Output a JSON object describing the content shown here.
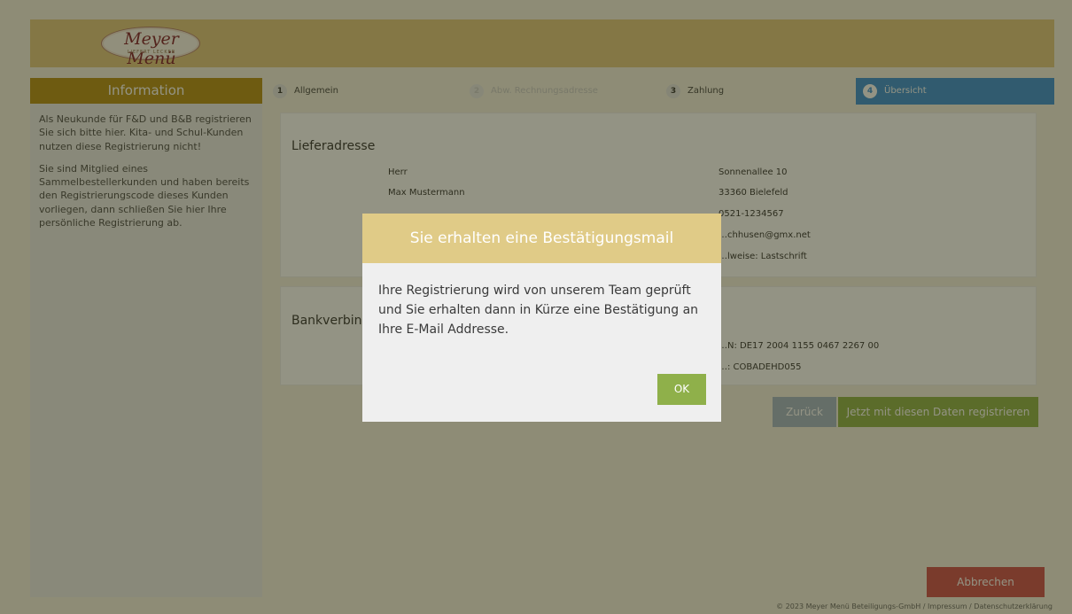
{
  "header": {
    "logo_text": "Meyer Menü",
    "logo_tagline": "LIEFERT LECKER"
  },
  "sidebar": {
    "title": "Information",
    "paragraph1": "Als Neukunde für F&D und B&B registrieren Sie sich bitte hier. Kita- und Schul-Kunden nutzen diese Registrierung nicht!",
    "paragraph2": "Sie sind Mitglied eines Sammelbestellerkunden und haben bereits den Registrierungscode dieses Kunden vorliegen, dann schließen Sie hier Ihre persönliche Registrierung ab."
  },
  "steps": [
    {
      "number": "1",
      "label": "Allgemein"
    },
    {
      "number": "2",
      "label": "Abw. Rechnungsadresse"
    },
    {
      "number": "3",
      "label": "Zahlung"
    },
    {
      "number": "4",
      "label": "Übersicht"
    }
  ],
  "delivery": {
    "title": "Lieferadresse",
    "salutation": "Herr",
    "name": "Max Mustermann",
    "street": "Sonnenallee 10",
    "city": "33360 Bielefeld",
    "phone": "0521-1234567",
    "email": "…chhusen@gmx.net",
    "payment": "…lweise: Lastschrift"
  },
  "bank": {
    "title": "Bankverbind…",
    "iban": "…N: DE17 2004 1155 0467 2267 00",
    "bic": "…:  COBADEHD055"
  },
  "buttons": {
    "back": "Zurück",
    "register": "Jetzt mit diesen Daten registrieren",
    "cancel": "Abbrechen"
  },
  "footer": "© 2023 Meyer Menü Beteiligungs-GmbH / Impressum / Datenschutzerklärung",
  "modal": {
    "title": "Sie erhalten eine Bestätigungsmail",
    "body": "Ihre Registrierung wird von unserem Team geprüft und Sie erhalten dann in Kürze eine Bestätigung an Ihre E-Mail Addresse.",
    "ok": "OK"
  },
  "colors": {
    "gold": "#b58f19",
    "header": "#e0c680",
    "active_step": "#3a8fd4",
    "green": "#8fb04a",
    "red": "#cc4f4f"
  }
}
